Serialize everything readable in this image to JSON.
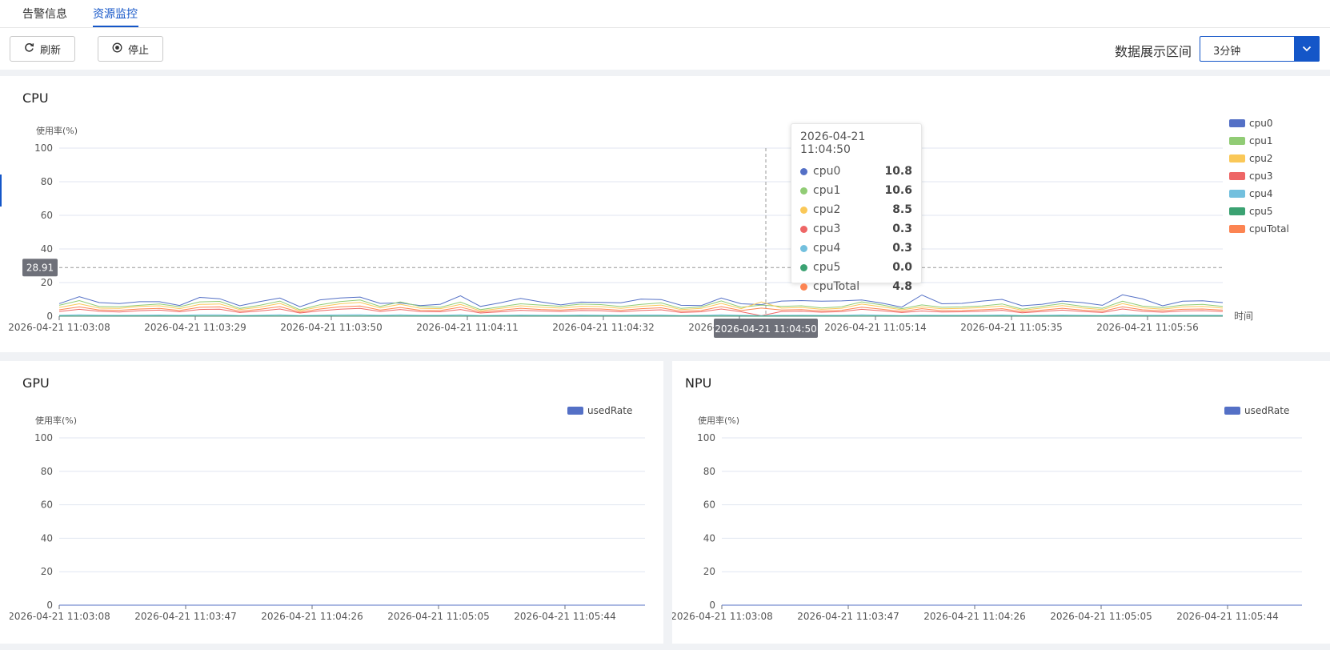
{
  "tabs": [
    {
      "label": "告警信息",
      "active": false
    },
    {
      "label": "资源监控",
      "active": true
    }
  ],
  "toolbar": {
    "refresh_label": "刷新",
    "stop_label": "停止",
    "range_label": "数据展示区间",
    "range_value": "3分钟"
  },
  "cpu_card": {
    "title": "CPU",
    "crosshair_y_label": "28.91",
    "crosshair_x_label": "2026-04-21 11:04:50",
    "tooltip": {
      "time": "2026-04-21 11:04:50",
      "rows": [
        {
          "name": "cpu0",
          "value": "10.8",
          "color": "#5470c6"
        },
        {
          "name": "cpu1",
          "value": "10.6",
          "color": "#91cc75"
        },
        {
          "name": "cpu2",
          "value": "8.5",
          "color": "#fac858"
        },
        {
          "name": "cpu3",
          "value": "0.3",
          "color": "#ee6666"
        },
        {
          "name": "cpu4",
          "value": "0.3",
          "color": "#73c0de"
        },
        {
          "name": "cpu5",
          "value": "0.0",
          "color": "#3ba272"
        },
        {
          "name": "cpuTotal",
          "value": "4.8",
          "color": "#fc8452"
        }
      ]
    }
  },
  "gpu_card": {
    "title": "GPU"
  },
  "npu_card": {
    "title": "NPU"
  },
  "chart_data": [
    {
      "type": "line",
      "title": "CPU",
      "ylabel": "使用率(%)",
      "xlabel": "时间",
      "ylim": [
        0,
        100
      ],
      "yticks": [
        0,
        20,
        40,
        60,
        80,
        100
      ],
      "xtick_labels": [
        "2026-04-21 11:03:08",
        "2026-04-21 11:03:29",
        "2026-04-21 11:03:50",
        "2026-04-21 11:04:11",
        "2026-04-21 11:04:32",
        "2026-04-21 11:04:53",
        "2026-04-21 11:05:14",
        "2026-04-21 11:05:35",
        "2026-04-21 11:05:56"
      ],
      "legend_position": "right",
      "grid": true,
      "series": [
        {
          "name": "cpu0",
          "color": "#5470c6",
          "values": [
            7.5,
            11.6,
            8.1,
            7.5,
            8.6,
            8.6,
            6.4,
            11.2,
            10.4,
            6.2,
            8.7,
            10.8,
            5.6,
            9.7,
            10.8,
            11.4,
            7.6,
            7.9,
            6.3,
            7.1,
            12.1,
            5.8,
            8.0,
            10.6,
            8.5,
            6.7,
            8.4,
            8.2,
            8.0,
            10.2,
            9.9,
            6.5,
            6.3,
            10.8,
            7.4,
            6.9,
            9.0,
            9.3,
            8.9,
            9.1,
            9.6,
            7.8,
            5.4,
            12.6,
            7.4,
            7.6,
            9.0,
            10.0,
            6.2,
            7.1,
            9.0,
            8.1,
            6.5,
            12.7,
            10.3,
            6.2,
            8.9,
            9.2,
            8.1
          ]
        },
        {
          "name": "cpu1",
          "color": "#91cc75",
          "values": [
            6.5,
            9.3,
            5.7,
            5.6,
            6.5,
            7.3,
            5.6,
            8.5,
            8.8,
            4.6,
            6.5,
            9.0,
            3.8,
            6.8,
            8.7,
            9.6,
            5.8,
            8.5,
            5.8,
            5.3,
            8.4,
            3.9,
            5.6,
            7.4,
            6.6,
            5.9,
            7.2,
            6.9,
            5.7,
            7.0,
            7.9,
            4.6,
            5.5,
            9.1,
            5.3,
            6.6,
            5.8,
            6.2,
            4.9,
            5.6,
            8.5,
            6.7,
            4.5,
            6.7,
            5.3,
            5.5,
            6.1,
            7.3,
            4.2,
            5.9,
            7.5,
            5.9,
            4.7,
            8.9,
            6.0,
            5.1,
            6.6,
            7.0,
            5.8
          ]
        },
        {
          "name": "cpu2",
          "color": "#fac858",
          "values": [
            5.2,
            7.4,
            4.8,
            4.6,
            5.8,
            6.2,
            4.5,
            7.0,
            7.3,
            3.9,
            5.4,
            7.6,
            3.2,
            5.6,
            7.4,
            8.2,
            4.9,
            7.1,
            4.7,
            4.5,
            7.0,
            3.2,
            4.6,
            6.2,
            5.4,
            4.8,
            5.9,
            5.7,
            4.6,
            5.9,
            6.6,
            3.9,
            4.6,
            7.6,
            4.5,
            8.5,
            4.8,
            5.2,
            4.1,
            4.7,
            7.2,
            5.6,
            3.8,
            5.5,
            4.4,
            4.6,
            5.1,
            6.1,
            3.5,
            4.9,
            6.3,
            4.9,
            3.9,
            7.5,
            5.0,
            4.2,
            5.5,
            5.8,
            4.8
          ]
        },
        {
          "name": "cpu3",
          "color": "#ee6666",
          "values": [
            2.8,
            4.1,
            2.9,
            2.5,
            3.3,
            3.6,
            2.6,
            4.0,
            4.2,
            2.2,
            3.1,
            4.3,
            1.9,
            3.2,
            4.2,
            4.6,
            2.8,
            4.0,
            2.7,
            2.6,
            4.0,
            1.9,
            2.6,
            3.5,
            3.1,
            2.8,
            3.4,
            3.3,
            2.6,
            3.4,
            3.8,
            2.2,
            2.6,
            4.3,
            2.6,
            0.3,
            2.8,
            3.0,
            2.4,
            2.7,
            4.1,
            3.2,
            2.2,
            3.1,
            2.5,
            2.6,
            2.9,
            3.5,
            2.0,
            2.8,
            3.6,
            2.8,
            2.2,
            4.3,
            2.9,
            2.4,
            3.1,
            3.3,
            2.8
          ]
        },
        {
          "name": "cpu4",
          "color": "#73c0de",
          "values": [
            0.5,
            0.8,
            0.6,
            0.5,
            0.6,
            0.7,
            0.5,
            0.8,
            0.8,
            0.4,
            0.6,
            0.8,
            0.4,
            0.6,
            0.8,
            0.9,
            0.5,
            0.8,
            0.5,
            0.5,
            0.8,
            0.4,
            0.5,
            0.7,
            0.6,
            0.5,
            0.7,
            0.6,
            0.5,
            0.7,
            0.7,
            0.4,
            0.5,
            0.8,
            0.5,
            0.3,
            0.5,
            0.6,
            0.5,
            0.5,
            0.8,
            0.6,
            0.4,
            0.6,
            0.5,
            0.5,
            0.6,
            0.7,
            0.4,
            0.5,
            0.7,
            0.5,
            0.4,
            0.8,
            0.6,
            0.5,
            0.6,
            0.6,
            0.5
          ]
        },
        {
          "name": "cpu5",
          "color": "#3ba272",
          "values": [
            0.1,
            0.1,
            0.1,
            0.1,
            0.1,
            0.1,
            0.1,
            0.1,
            0.1,
            0.1,
            0.1,
            0.1,
            0.1,
            0.1,
            0.1,
            0.1,
            0.1,
            0.1,
            0.1,
            0.1,
            0.1,
            0.1,
            0.1,
            0.1,
            0.1,
            0.1,
            0.1,
            0.1,
            0.1,
            0.1,
            0.1,
            0.1,
            0.1,
            0.1,
            0.1,
            0.0,
            0.1,
            0.1,
            0.1,
            0.1,
            0.1,
            0.1,
            0.1,
            0.1,
            0.1,
            0.1,
            0.1,
            0.1,
            0.1,
            0.1,
            0.1,
            0.1,
            0.1,
            0.1,
            0.1,
            0.1,
            0.1,
            0.1,
            0.1
          ]
        },
        {
          "name": "cpuTotal",
          "color": "#fc8452",
          "values": [
            3.8,
            5.5,
            3.7,
            3.5,
            4.3,
            4.6,
            3.4,
            5.3,
            5.5,
            2.9,
            4.1,
            5.7,
            2.4,
            4.3,
            5.6,
            6.1,
            3.6,
            5.2,
            3.5,
            3.4,
            5.4,
            2.5,
            3.5,
            4.7,
            4.0,
            3.6,
            4.4,
            4.3,
            3.5,
            4.5,
            5.0,
            2.9,
            3.4,
            5.7,
            3.4,
            4.8,
            3.7,
            3.9,
            3.1,
            3.5,
            5.4,
            4.2,
            2.8,
            4.5,
            3.3,
            3.4,
            3.8,
            4.5,
            2.6,
            3.6,
            4.7,
            3.6,
            2.9,
            5.6,
            3.8,
            3.2,
            4.1,
            4.3,
            3.6
          ]
        }
      ]
    },
    {
      "type": "line",
      "title": "GPU",
      "ylabel": "使用率(%)",
      "ylim": [
        0,
        100
      ],
      "yticks": [
        0,
        20,
        40,
        60,
        80,
        100
      ],
      "xtick_labels": [
        "2026-04-21 11:03:08",
        "2026-04-21 11:03:47",
        "2026-04-21 11:04:26",
        "2026-04-21 11:05:05",
        "2026-04-21 11:05:44"
      ],
      "legend_position": "top-right",
      "grid": true,
      "series": [
        {
          "name": "usedRate",
          "color": "#5470c6",
          "values": [
            0,
            0
          ]
        }
      ]
    },
    {
      "type": "line",
      "title": "NPU",
      "ylabel": "使用率(%)",
      "ylim": [
        0,
        100
      ],
      "yticks": [
        0,
        20,
        40,
        60,
        80,
        100
      ],
      "xtick_labels": [
        "2026-04-21 11:03:08",
        "2026-04-21 11:03:47",
        "2026-04-21 11:04:26",
        "2026-04-21 11:05:05",
        "2026-04-21 11:05:44"
      ],
      "legend_position": "top-right",
      "grid": true,
      "series": [
        {
          "name": "usedRate",
          "color": "#5470c6",
          "values": [
            0,
            0
          ]
        }
      ]
    }
  ]
}
